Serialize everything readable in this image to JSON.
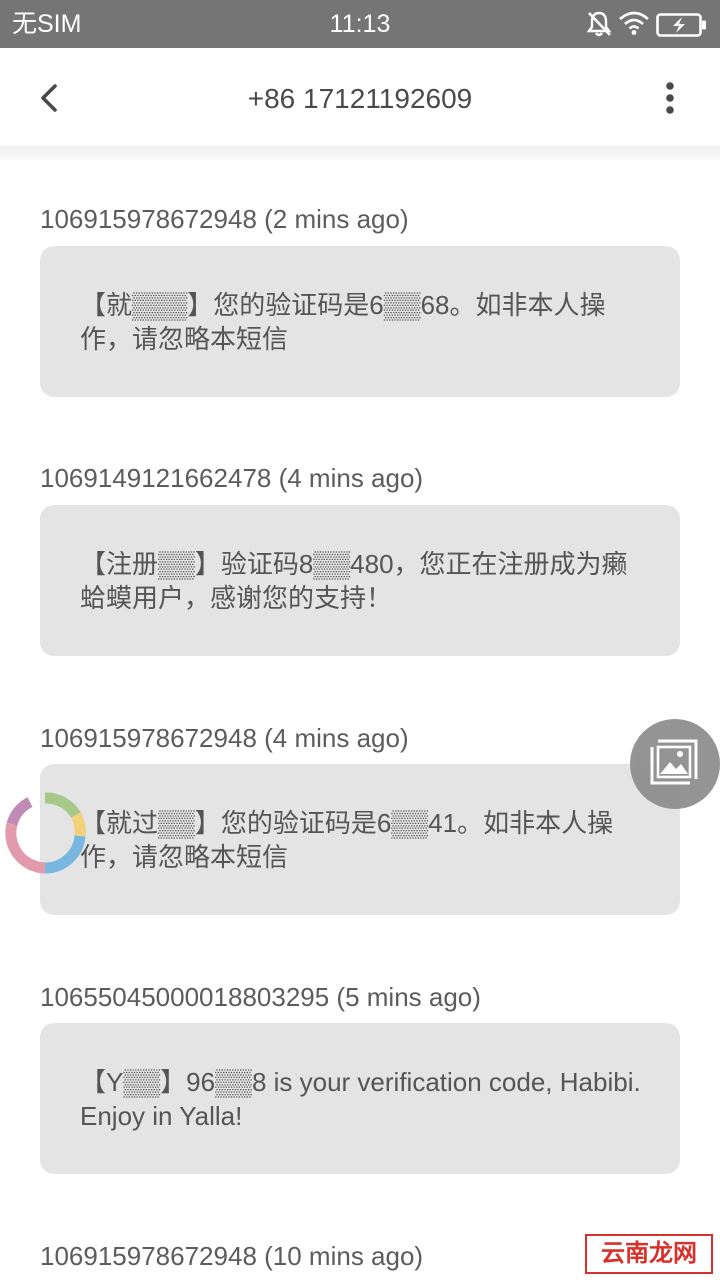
{
  "status_bar": {
    "carrier": "无SIM",
    "time": "11:13",
    "icons": [
      "bell-off-icon",
      "wifi-icon",
      "battery-charging-icon"
    ]
  },
  "header": {
    "back_icon": "chevron-left-icon",
    "title": "+86 17121192609",
    "more_icon": "more-vertical-icon"
  },
  "messages": [
    {
      "sender": "106915978672948 (2 mins ago)",
      "text": "【就▒▒▒】您的验证码是6▒▒68。如非本人操作，请忽略本短信"
    },
    {
      "sender": "1069149121662478 (4 mins ago)",
      "text": "【注册▒▒】验证码8▒▒480，您正在注册成为癞蛤蟆用户，感谢您的支持！"
    },
    {
      "sender": "106915978672948 (4 mins ago)",
      "text": "【就过▒▒】您的验证码是6▒▒41。如非本人操作，请忽略本短信"
    },
    {
      "sender": "10655045000018803295 (5 mins ago)",
      "text": "【Y▒▒】96▒▒8 is your verification code, Habibi. Enjoy in Yalla!"
    },
    {
      "sender": "106915978672948 (10 mins ago)",
      "text": ""
    }
  ],
  "floating": {
    "image_button_icon": "image-crop-icon",
    "loading_icon": "loading-ring-icon"
  },
  "watermark": {
    "text": "云南龙网"
  },
  "colors": {
    "status_bar": "#757575",
    "bubble": "#e4e4e4",
    "text": "#555555",
    "watermark": "#d6322b"
  }
}
